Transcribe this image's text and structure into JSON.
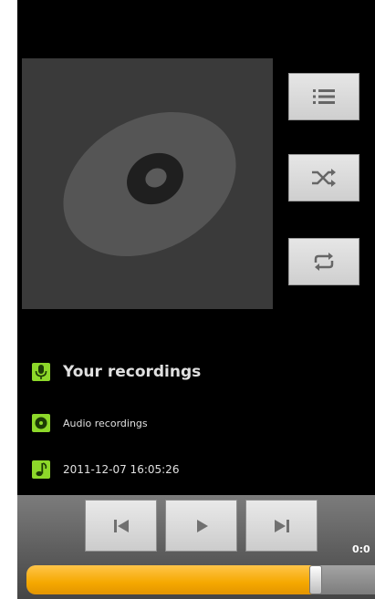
{
  "album": {
    "title": "Your recordings",
    "artist": "Audio recordings",
    "date": "2011-12-07 16:05:26"
  },
  "icons": {
    "album_art": "disc-icon",
    "playlist": "list-icon",
    "shuffle": "shuffle-icon",
    "repeat": "repeat-icon",
    "title": "microphone-icon",
    "artist": "disc-icon",
    "date": "music-note-icon",
    "previous": "previous-icon",
    "play": "play-icon",
    "next": "next-icon"
  },
  "playback": {
    "time": "0:0",
    "progress": 0.83
  },
  "colors": {
    "accent": "#8dd82a",
    "progress": "#f5a800"
  }
}
